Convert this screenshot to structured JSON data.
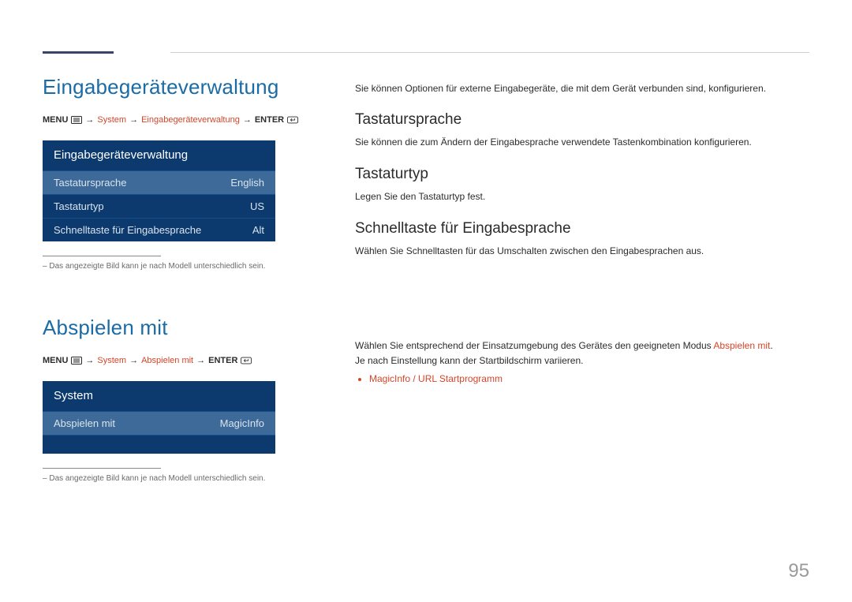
{
  "page_number": "95",
  "left": {
    "section1": {
      "title": "Eingabegeräteverwaltung",
      "crumb": {
        "menu": "MENU",
        "arrow": "→",
        "part2": "System",
        "part3": "Eingabegeräteverwaltung",
        "enter": "ENTER"
      },
      "menu": {
        "header": "Eingabegeräteverwaltung",
        "rows": [
          {
            "label": "Tastatursprache",
            "value": "English"
          },
          {
            "label": "Tastaturtyp",
            "value": "US"
          },
          {
            "label": "Schnelltaste für Eingabesprache",
            "value": "Alt"
          }
        ]
      },
      "note": "Das angezeigte Bild kann je nach Modell unterschiedlich sein."
    },
    "section2": {
      "title": "Abspielen mit",
      "crumb": {
        "menu": "MENU",
        "arrow": "→",
        "part2": "System",
        "part3": "Abspielen mit",
        "enter": "ENTER"
      },
      "menu": {
        "header": "System",
        "rows": [
          {
            "label": "Abspielen mit",
            "value": "MagicInfo"
          }
        ]
      },
      "note": "Das angezeigte Bild kann je nach Modell unterschiedlich sein."
    }
  },
  "right": {
    "intro": "Sie können Optionen für externe Eingabegeräte, die mit dem Gerät verbunden sind, konfigurieren.",
    "sections": [
      {
        "heading": "Tastatursprache",
        "body": "Sie können die zum Ändern der Eingabesprache verwendete Tastenkombination konfigurieren."
      },
      {
        "heading": "Tastaturtyp",
        "body": "Legen Sie den Tastaturtyp fest."
      },
      {
        "heading": "Schnelltaste für Eingabesprache",
        "body": "Wählen Sie Schnelltasten für das Umschalten zwischen den Eingabesprachen aus."
      }
    ],
    "block2": {
      "line1_pre": "Wählen Sie entsprechend der Einsatzumgebung des Gerätes den geeigneten Modus ",
      "line1_accent": "Abspielen mit",
      "line1_post": ".",
      "line2": "Je nach Einstellung kann der Startbildschirm variieren.",
      "bullet": "MagicInfo / URL Startprogramm"
    }
  }
}
